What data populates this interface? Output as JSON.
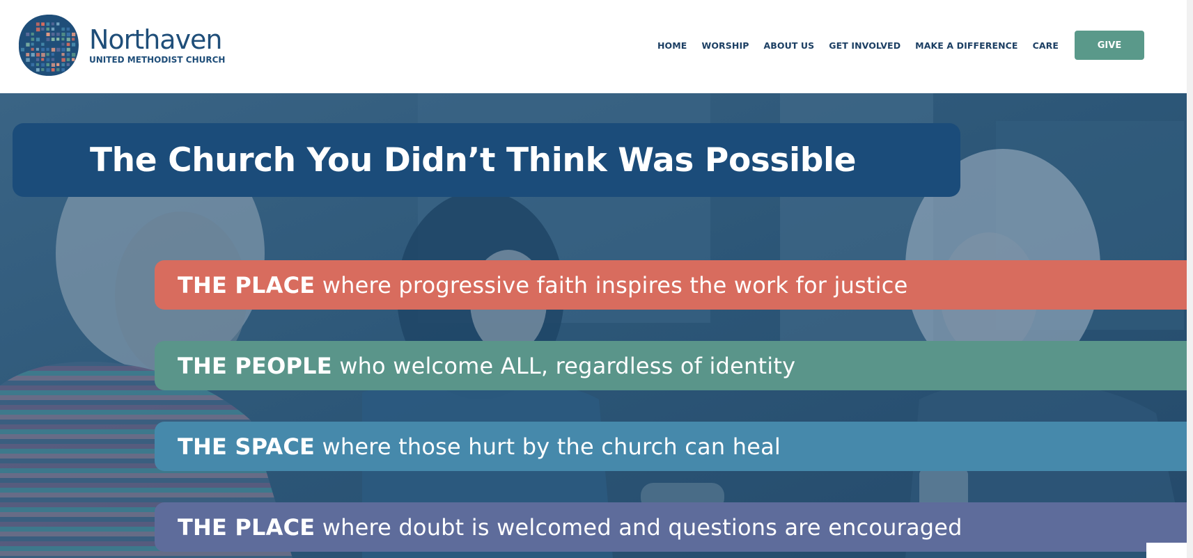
{
  "brand": {
    "name": "Northaven",
    "subtitle": "UNITED METHODIST CHURCH",
    "colors": {
      "navy": "#1f4e79",
      "green": "#5a998a",
      "coral": "#d86c5e",
      "blue": "#4689ab",
      "purple": "#5e6c9b"
    }
  },
  "nav": {
    "items": [
      {
        "label": "HOME"
      },
      {
        "label": "WORSHIP"
      },
      {
        "label": "ABOUT US"
      },
      {
        "label": "GET INVOLVED"
      },
      {
        "label": "MAKE A DIFFERENCE"
      },
      {
        "label": "CARE"
      }
    ],
    "give_label": "GIVE"
  },
  "hero": {
    "title": "The Church You Didn’t Think Was Possible",
    "bands": [
      {
        "lead": "THE PLACE",
        "text": " where progressive faith inspires the work for justice",
        "color": "#d86c5e"
      },
      {
        "lead": "THE PEOPLE",
        "text": " who welcome ALL, regardless of identity",
        "color": "#5a958a"
      },
      {
        "lead": "THE SPACE",
        "text": " where those hurt by the church can heal",
        "color": "#4689ab"
      },
      {
        "lead": "THE PLACE",
        "text": " where doubt is welcomed and questions are encouraged",
        "color": "#5e6c9b"
      }
    ]
  }
}
